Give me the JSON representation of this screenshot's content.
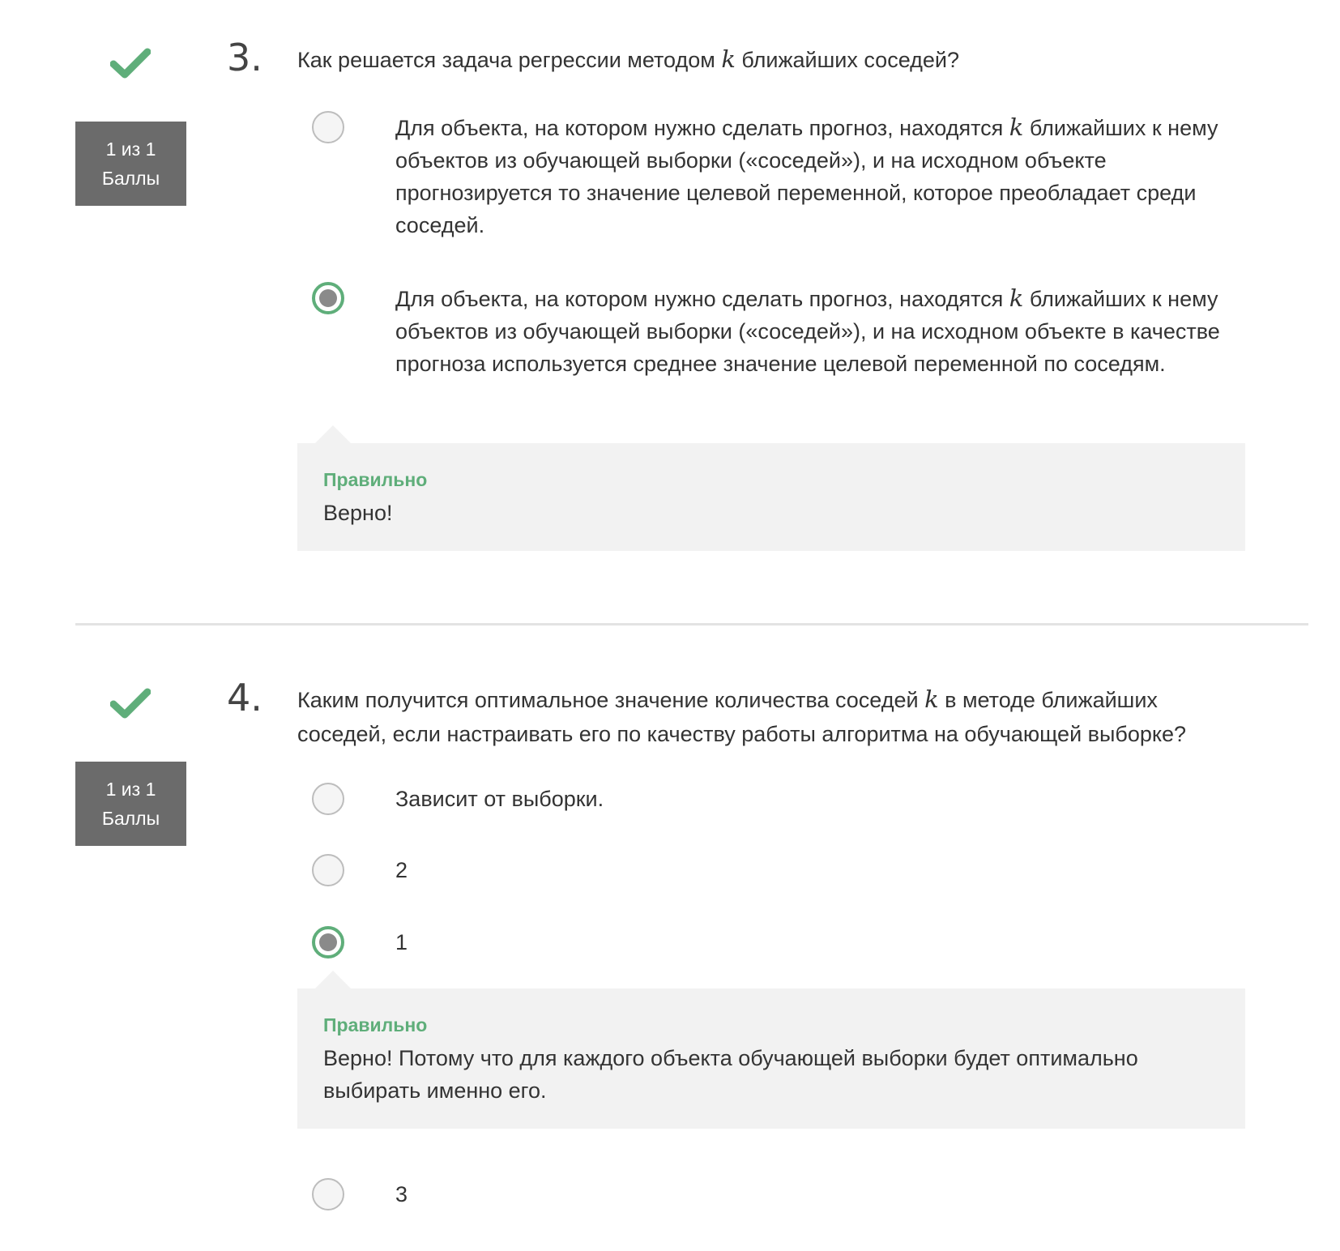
{
  "colors": {
    "correct_green": "#5fae7a",
    "badge_gray": "#6b6b6b",
    "feedback_bg": "#f2f2f2"
  },
  "questions": [
    {
      "number": "3.",
      "status_icon": "check-icon",
      "score_line1": "1 из 1",
      "score_line2": "Баллы",
      "text_before_k": "Как решается задача регрессии методом ",
      "k": "k",
      "text_after_k": " ближайших соседей?",
      "options": [
        {
          "before_k": "Для объекта, на котором нужно сделать прогноз, находятся ",
          "k": "k",
          "after_k": " ближайших к нему объектов из обучающей выборки («соседей»), и на исходном объекте прогнозируется то значение целевой переменной, которое преобладает среди соседей.",
          "selected": false
        },
        {
          "before_k": "Для объекта, на котором нужно сделать прогноз, находятся ",
          "k": "k",
          "after_k": " ближайших к нему объектов из обучающей выборки («соседей»), и на исходном объекте в качестве прогноза используется среднее значение целевой переменной по соседям.",
          "selected": true
        }
      ],
      "feedback": {
        "title": "Правильно",
        "text": "Верно!"
      }
    },
    {
      "number": "4.",
      "status_icon": "check-icon",
      "score_line1": "1 из 1",
      "score_line2": "Баллы",
      "text_before_k": "Каким получится оптимальное значение количества соседей ",
      "k": "k",
      "text_after_k": " в методе ближайших соседей, если настраивать его по качеству работы алгоритма на обучающей выборке?",
      "options": [
        {
          "text": "Зависит от выборки.",
          "selected": false
        },
        {
          "text": "2",
          "selected": false
        },
        {
          "text": "1",
          "selected": true
        },
        {
          "text": "3",
          "selected": false
        }
      ],
      "feedback": {
        "title": "Правильно",
        "text": "Верно! Потому что для каждого объекта обучающей выборки будет оптимально выбирать именно его."
      }
    }
  ]
}
